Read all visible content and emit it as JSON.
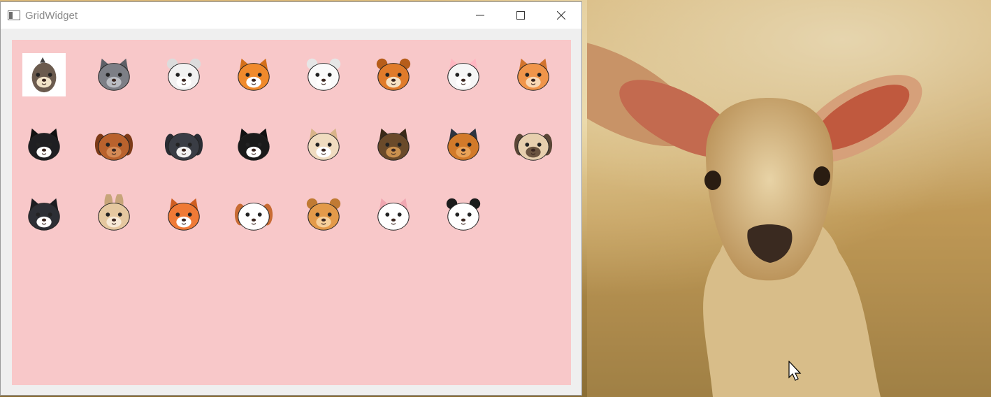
{
  "window": {
    "title": "GridWidget",
    "controls": {
      "minimize": "minimize-icon",
      "maximize": "maximize-icon",
      "close": "close-icon"
    }
  },
  "grid": {
    "background_color": "#f8c8c9",
    "selected_index": 0,
    "items": [
      "bird-icon",
      "gray-cat-icon",
      "poodle-icon",
      "shiba-icon",
      "pomeranian-icon",
      "chipmunk-icon",
      "white-cat-icon",
      "ginger-cat-icon",
      "tuxedo-cat-icon",
      "mastiff-icon",
      "shih-tzu-icon",
      "papillon-icon",
      "french-bulldog-icon",
      "german-shepherd-icon",
      "yorkie-icon",
      "pug-icon",
      "black-white-cat-icon",
      "rabbit-icon",
      "fox-icon",
      "cavalier-spaniel-icon",
      "bear-icon",
      "persian-cat-icon",
      "panda-icon"
    ]
  },
  "desktop": {
    "wallpaper": "lamb-wallpaper"
  }
}
